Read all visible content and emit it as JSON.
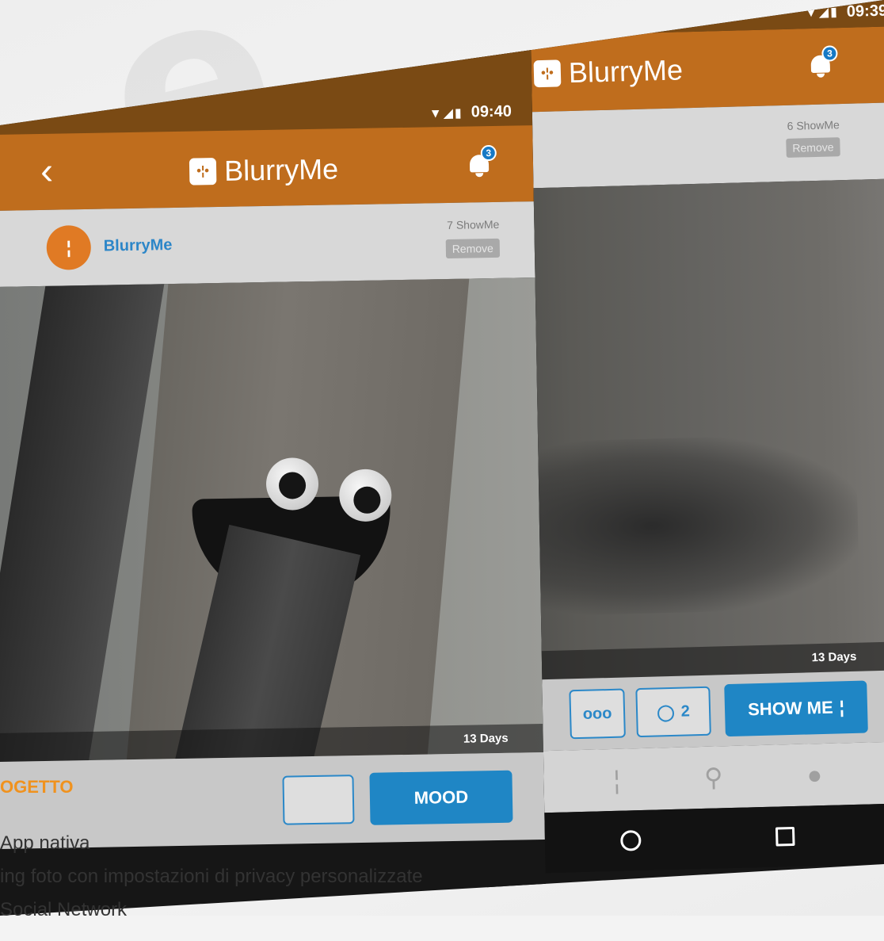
{
  "back_screen": {
    "status_time": "09:39",
    "app_name": "BlurryMe",
    "notification_count": "3",
    "showme_count": "6 ShowMe",
    "remove_label": "Remove",
    "days_label": "13 Days",
    "more_label": "ooo",
    "comment_count": "2",
    "show_me_label": "SHOW ME"
  },
  "front_screen": {
    "status_time": "09:40",
    "app_name": "BlurryMe",
    "notification_count": "3",
    "username": "BlurryMe",
    "showme_count": "7 ShowMe",
    "remove_label": "Remove",
    "days_label": "13 Days",
    "mood_label": "MOOD"
  },
  "caption": {
    "title": "OGETTO",
    "line1": "App nativa",
    "line2": "ing foto con impostazioni di privacy personalizzate",
    "line3": "Social Network"
  },
  "colors": {
    "brand_orange": "#bf6d1d",
    "accent_blue": "#1f86c5",
    "caption_orange": "#f0921e"
  }
}
